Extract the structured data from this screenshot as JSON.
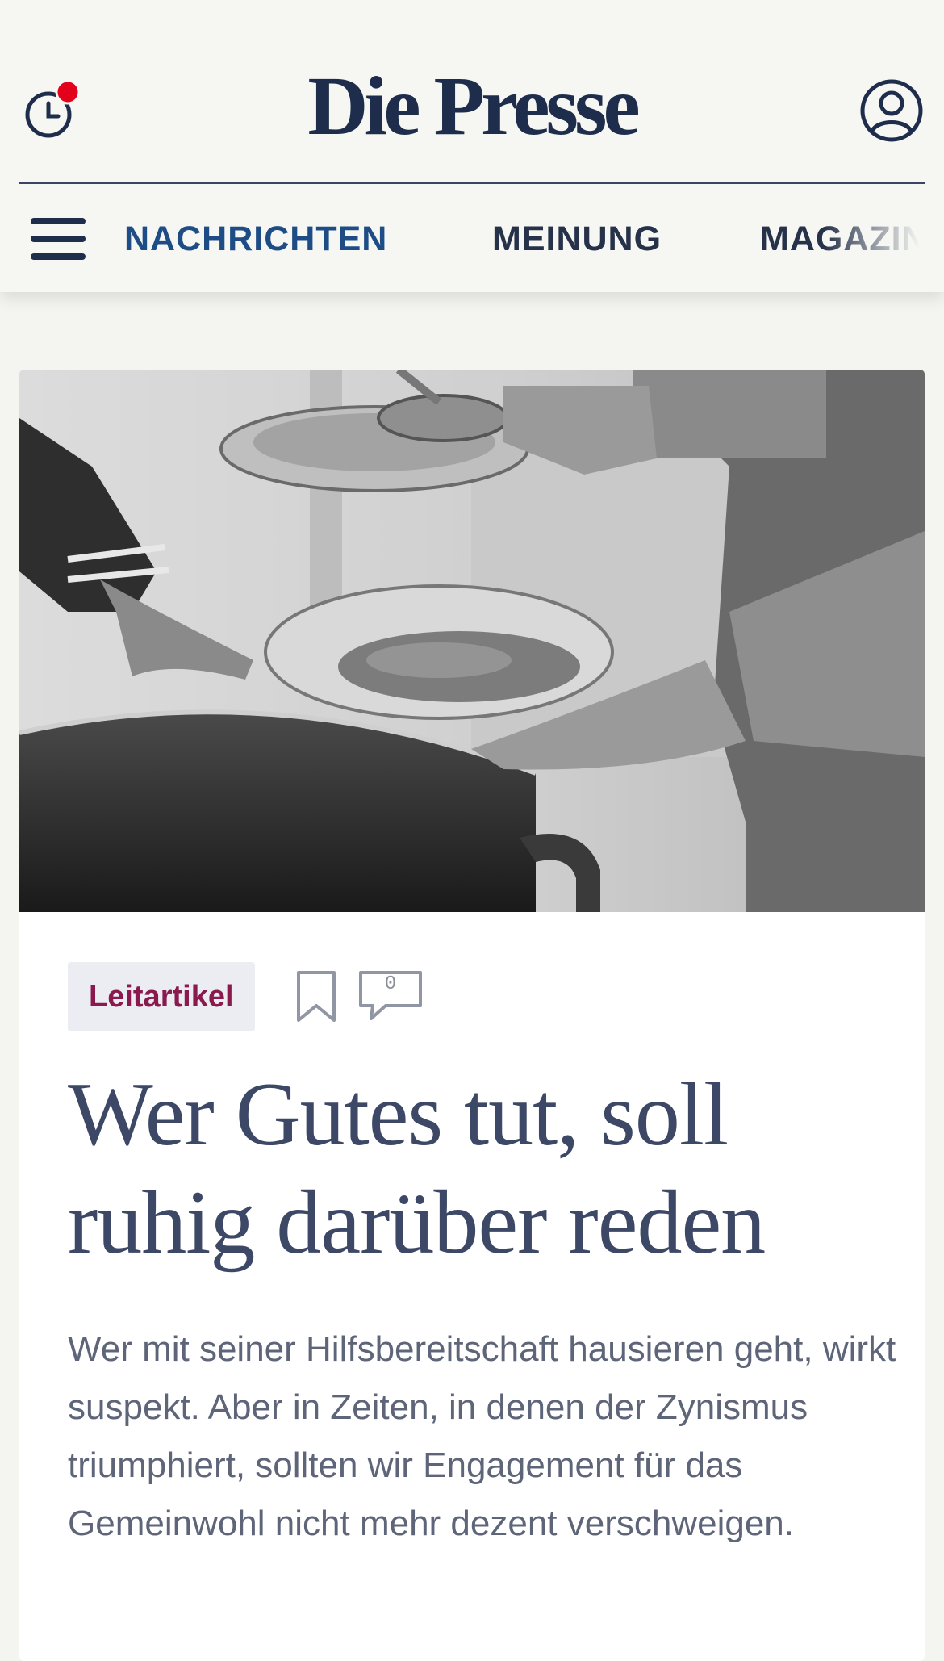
{
  "header": {
    "logo": "Die Presse"
  },
  "nav": {
    "items": [
      {
        "label": "NACHRICHTEN",
        "active": true
      },
      {
        "label": "MEINUNG",
        "active": false
      },
      {
        "label": "MAGAZIN",
        "active": false
      }
    ]
  },
  "article": {
    "category": "Leitartikel",
    "comment_count": "0",
    "headline": "Wer Gutes tut, soll ruhig darüber reden",
    "lead": "Wer mit seiner Hilfsbereitschaft hausieren geht, wirkt suspekt. Aber in Zeiten, in denen der Zynismus triumphiert, sollten wir Engagement für das Gemeinwohl nicht mehr dezent verschweigen."
  },
  "colors": {
    "brand": "#1d2d4b",
    "nav_active": "#1e4d86",
    "category": "#8a1a4d",
    "notification_dot": "#e3001b"
  },
  "icons": [
    "history-icon",
    "account-icon",
    "menu-icon",
    "bookmark-icon",
    "comment-icon"
  ]
}
